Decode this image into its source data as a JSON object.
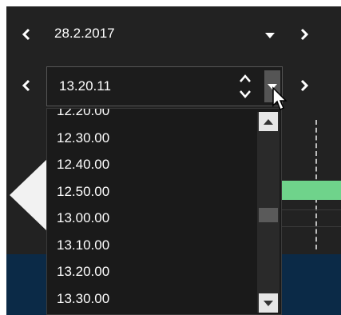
{
  "date_row": {
    "date_value": "28.2.2017"
  },
  "time_row": {
    "time_value": "13.20.11"
  },
  "time_dropdown": {
    "options": [
      "12.20.00",
      "12.30.00",
      "12.40.00",
      "12.50.00",
      "13.00.00",
      "13.10.00",
      "13.20.00",
      "13.30.00"
    ]
  },
  "icons": {
    "prev_date": "chevron-left-icon",
    "next_date": "chevron-right-icon",
    "date_dropdown": "caret-down-icon",
    "prev_time": "chevron-left-icon",
    "next_time": "chevron-right-icon",
    "spinner": "spinner-up-down-icon",
    "time_dropdown": "caret-down-icon",
    "cursor": "mouse-pointer-icon"
  },
  "colors": {
    "panel_bg": "#222222",
    "navy_strip": "#0b2a47",
    "timeline_bar": "#6fd38b"
  }
}
